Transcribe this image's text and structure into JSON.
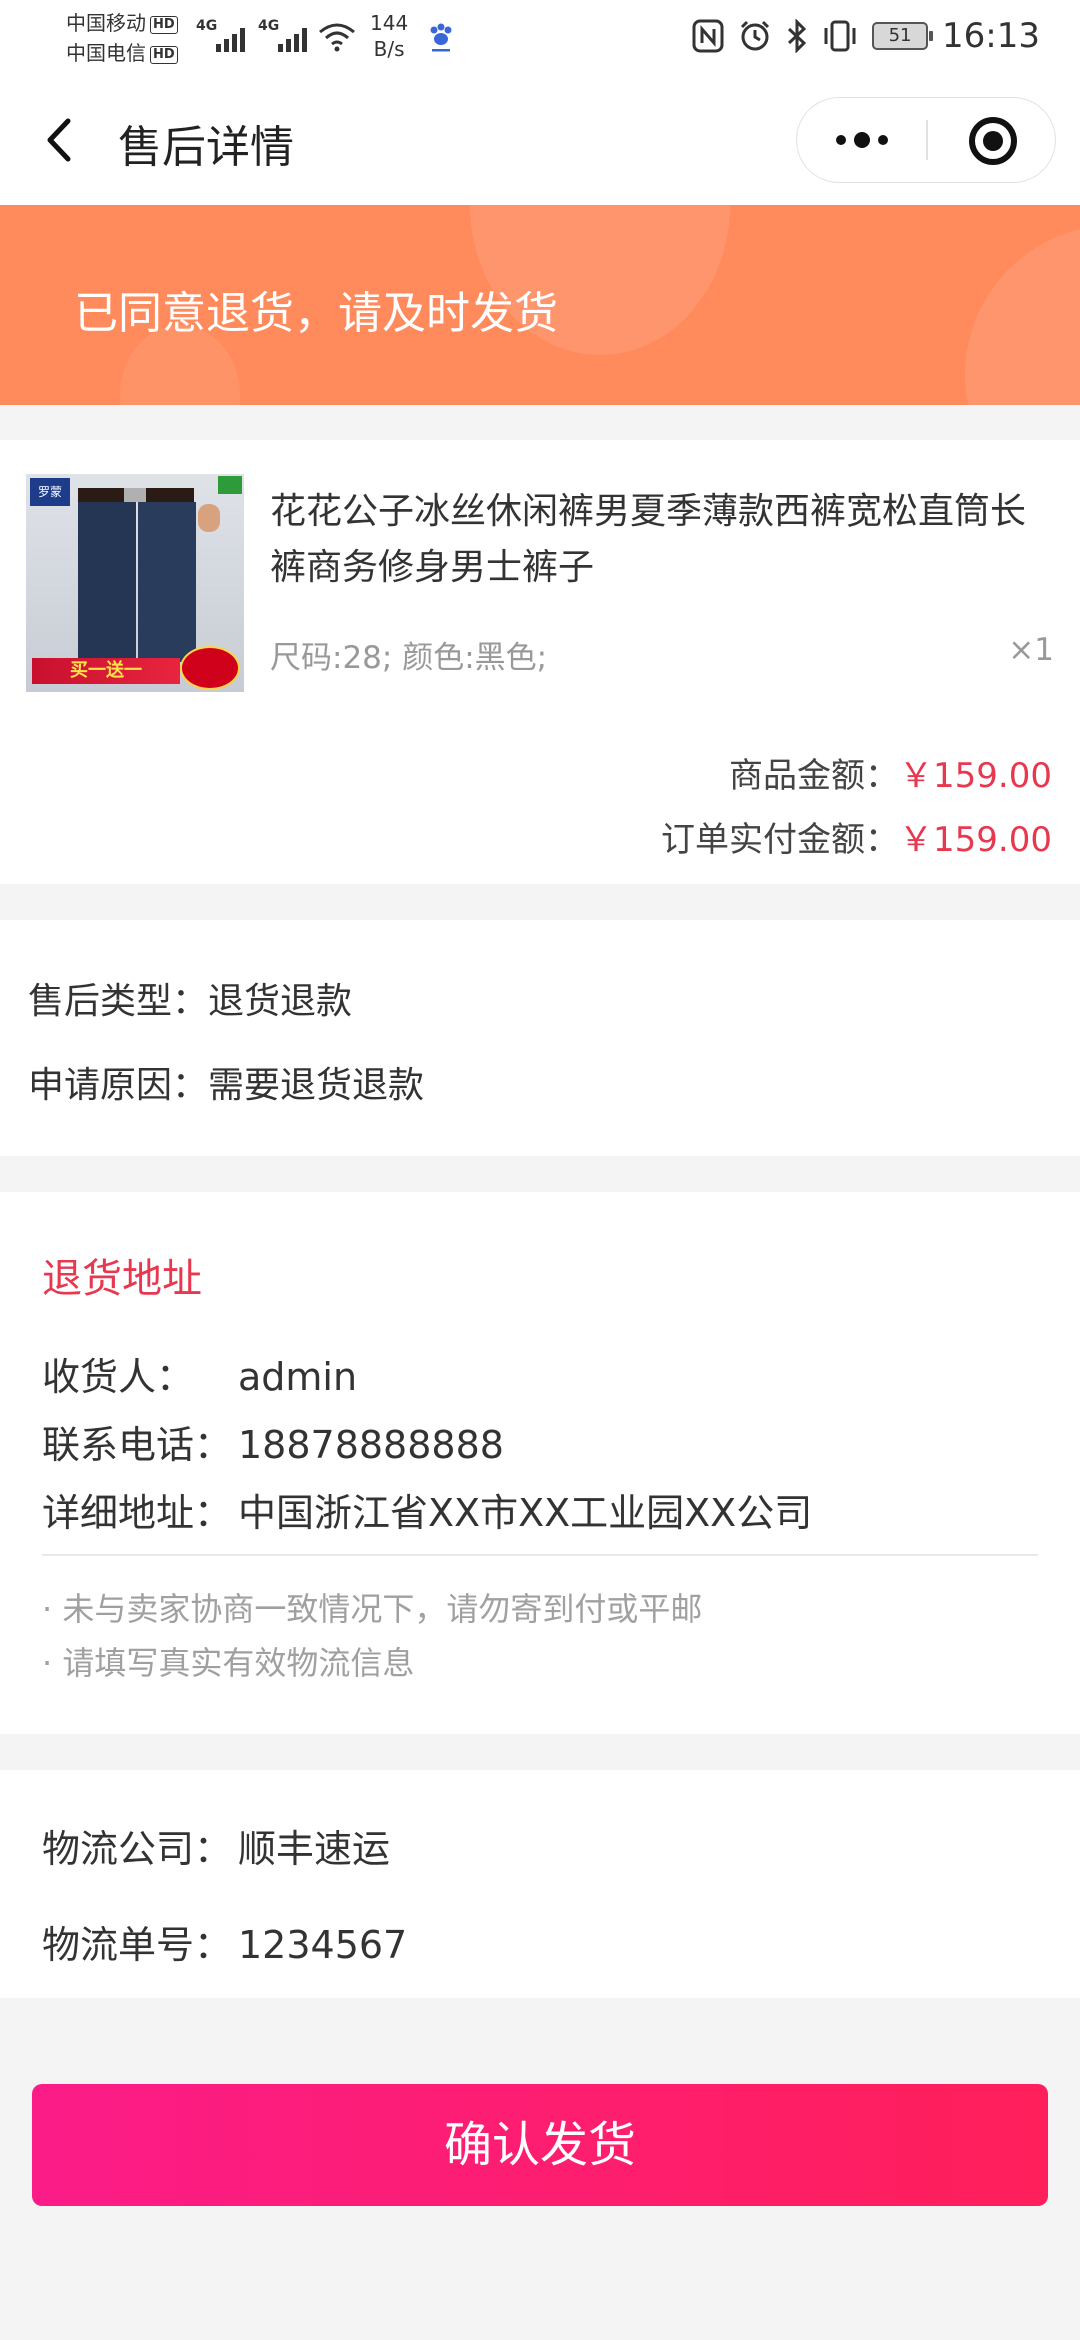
{
  "status_bar": {
    "carrier1": "中国移动",
    "carrier2": "中国电信",
    "hd_badge": "HD",
    "network1": "4G",
    "network2": "4G",
    "speed_value": "144",
    "speed_unit": "B/s",
    "battery": "51",
    "time": "16:13"
  },
  "nav": {
    "title": "售后详情"
  },
  "banner": {
    "text": "已同意退货，请及时发货"
  },
  "product": {
    "title": "花花公子冰丝休闲裤男夏季薄款西裤宽松直筒长裤商务修身男士裤子",
    "spec": "尺码:28; 颜色:黑色;",
    "quantity": "×1",
    "thumb_brand": "罗蒙",
    "thumb_promo": "买一送一",
    "goods_amount_label": "商品金额：",
    "goods_amount": "￥159.00",
    "paid_amount_label": "订单实付金额：",
    "paid_amount": "￥159.00"
  },
  "after_sale": {
    "type_label": "售后类型：",
    "type_value": "退货退款",
    "reason_label": "申请原因：",
    "reason_value": "需要退货退款"
  },
  "return_address": {
    "section_title": "退货地址",
    "receiver_label": "收货人：",
    "receiver_value": "admin",
    "phone_label": "联系电话：",
    "phone_value": "18878888888",
    "address_label": "详细地址：",
    "address_value": "中国浙江省XX市XX工业园XX公司",
    "notes": [
      "· 未与卖家协商一致情况下，请勿寄到付或平邮",
      "· 请填写真实有效物流信息"
    ]
  },
  "logistics": {
    "company_label": "物流公司：",
    "company_value": "顺丰速运",
    "number_label": "物流单号：",
    "number_value": "1234567"
  },
  "actions": {
    "confirm_label": "确认发货"
  },
  "colors": {
    "banner": "#ff8a5c",
    "accent_red": "#e8384f",
    "button_start": "#fb1c88",
    "button_end": "#ff1f5a"
  },
  "icons": {
    "back": "chevron-left-icon",
    "more": "more-dots-icon",
    "close_miniprogram": "target-circle-icon"
  }
}
